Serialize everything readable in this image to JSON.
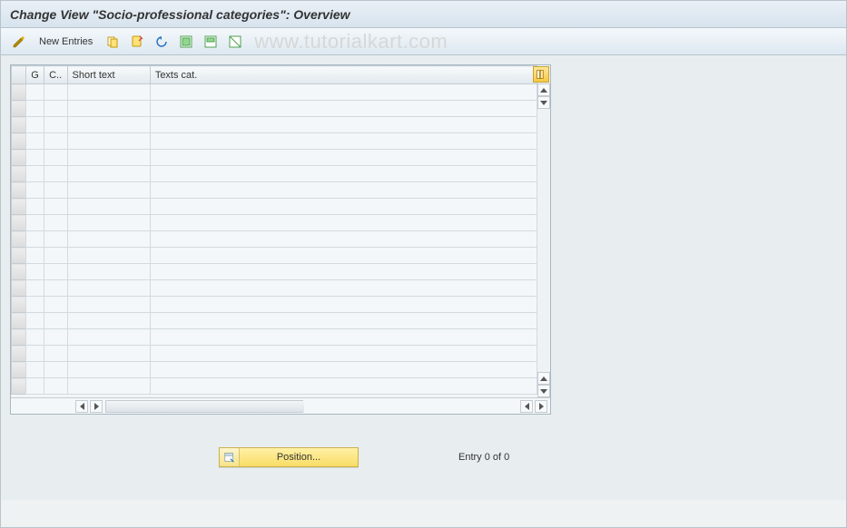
{
  "title": "Change View \"Socio-professional categories\": Overview",
  "toolbar": {
    "new_entries_label": "New Entries"
  },
  "watermark": "www.tutorialkart.com",
  "table": {
    "columns": {
      "g": "G",
      "c": "C..",
      "short": "Short text",
      "text": "Texts cat."
    },
    "row_count": 19
  },
  "bottom": {
    "position_label": "Position...",
    "entry_status": "Entry 0 of 0"
  }
}
